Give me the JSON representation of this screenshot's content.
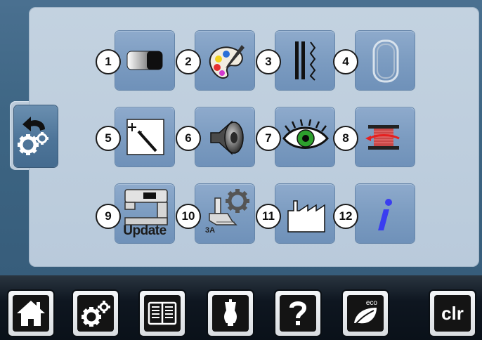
{
  "setup_menu": {
    "back_tab_icon": "back-settings-icon",
    "buttons": [
      {
        "number": "1",
        "icon": "contrast-icon"
      },
      {
        "number": "2",
        "icon": "color-palette-icon"
      },
      {
        "number": "3",
        "icon": "stitch-settings-icon"
      },
      {
        "number": "4",
        "icon": "embroidery-hoop-icon"
      },
      {
        "number": "5",
        "icon": "touch-calibration-icon"
      },
      {
        "number": "6",
        "icon": "speaker-icon"
      },
      {
        "number": "7",
        "icon": "eye-icon"
      },
      {
        "number": "8",
        "icon": "bobbin-monitor-icon"
      },
      {
        "number": "9",
        "icon": "sewing-machine-update-icon",
        "label": "Update"
      },
      {
        "number": "10",
        "icon": "presser-foot-gear-icon",
        "label": "3A"
      },
      {
        "number": "11",
        "icon": "factory-icon"
      },
      {
        "number": "12",
        "icon": "info-icon"
      }
    ]
  },
  "bottom_nav": {
    "items": [
      {
        "icon": "home-icon"
      },
      {
        "icon": "settings-gears-icon"
      },
      {
        "icon": "tutorial-book-icon"
      },
      {
        "icon": "creative-consultant-icon"
      },
      {
        "icon": "help-question-icon"
      },
      {
        "icon": "eco-leaf-icon",
        "label": "eco"
      },
      {
        "icon": "clear-icon",
        "label": "clr"
      }
    ]
  },
  "colors": {
    "panel": "#c0d0df",
    "button": "#7e9ec3",
    "background": "#416a8a",
    "nav_bar": "#0d1720",
    "info_blue": "#3a3df0"
  }
}
